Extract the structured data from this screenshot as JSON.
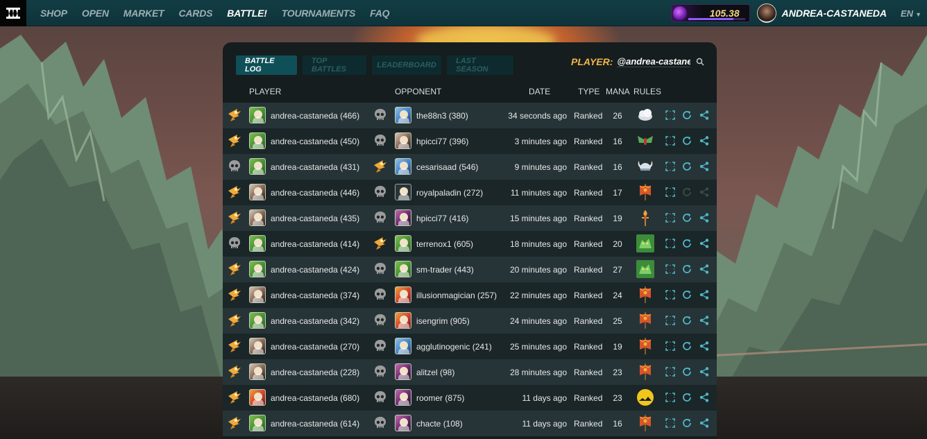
{
  "nav": {
    "items": [
      {
        "label": "SHOP",
        "active": false
      },
      {
        "label": "OPEN",
        "active": false
      },
      {
        "label": "MARKET",
        "active": false
      },
      {
        "label": "CARDS",
        "active": false
      },
      {
        "label": "BATTLE!",
        "active": true
      },
      {
        "label": "TOURNAMENTS",
        "active": false
      },
      {
        "label": "FAQ",
        "active": false
      }
    ],
    "balance": "105.38",
    "username": "ANDREA-CASTANEDA",
    "language": "EN"
  },
  "tabs": [
    {
      "label": "BATTLE LOG",
      "active": true
    },
    {
      "label": "TOP BATTLES",
      "active": false
    },
    {
      "label": "LEADERBOARD",
      "active": false
    },
    {
      "label": "LAST SEASON",
      "active": false
    }
  ],
  "search": {
    "label": "PLAYER:",
    "value": "@andrea-castaneda"
  },
  "columns": {
    "player": "PLAYER",
    "opponent": "OPPONENT",
    "date": "DATE",
    "type": "TYPE",
    "mana": "MANA",
    "rules": "RULES"
  },
  "colors": {
    "accent": "#f3b54b",
    "topbar": "#123d44",
    "panel": "#151d1e",
    "row_odd": "#263437",
    "row_even": "#1b2628",
    "icon": "#4fb8c9"
  },
  "battles": [
    {
      "player": "andrea-castaneda (466)",
      "player_result": "win",
      "player_card": "life",
      "opponent": "the88n3 (380)",
      "opponent_result": "loss",
      "opponent_card": "water",
      "date": "34 seconds ago",
      "type": "Ranked",
      "mana": "26",
      "rule_icon": "cloud-rule-icon",
      "replay_enabled": true
    },
    {
      "player": "andrea-castaneda (450)",
      "player_result": "win",
      "player_card": "life",
      "opponent": "hpicci77 (396)",
      "opponent_result": "loss",
      "opponent_card": "human",
      "date": "3 minutes ago",
      "type": "Ranked",
      "mana": "16",
      "rule_icon": "wings-rule-icon",
      "replay_enabled": true
    },
    {
      "player": "andrea-castaneda (431)",
      "player_result": "loss",
      "player_card": "life",
      "opponent": "cesarisaad (546)",
      "opponent_result": "win",
      "opponent_card": "water",
      "date": "9 minutes ago",
      "type": "Ranked",
      "mana": "16",
      "rule_icon": "viking-helmet-rule-icon",
      "replay_enabled": true
    },
    {
      "player": "andrea-castaneda (446)",
      "player_result": "win",
      "player_card": "human",
      "opponent": "royalpaladin (272)",
      "opponent_result": "loss",
      "opponent_card": "blank",
      "date": "11 minutes ago",
      "type": "Ranked",
      "mana": "17",
      "rule_icon": "banner-rule-icon",
      "replay_enabled": false
    },
    {
      "player": "andrea-castaneda (435)",
      "player_result": "win",
      "player_card": "human",
      "opponent": "hpicci77 (416)",
      "opponent_result": "loss",
      "opponent_card": "death",
      "date": "15 minutes ago",
      "type": "Ranked",
      "mana": "19",
      "rule_icon": "torch-rule-icon",
      "replay_enabled": true
    },
    {
      "player": "andrea-castaneda (414)",
      "player_result": "loss",
      "player_card": "life",
      "opponent": "terrenox1 (605)",
      "opponent_result": "win",
      "opponent_card": "life",
      "date": "18 minutes ago",
      "type": "Ranked",
      "mana": "20",
      "rule_icon": "earth-beast-rule-icon",
      "replay_enabled": true
    },
    {
      "player": "andrea-castaneda (424)",
      "player_result": "win",
      "player_card": "life",
      "opponent": "sm-trader (443)",
      "opponent_result": "loss",
      "opponent_card": "life",
      "date": "20 minutes ago",
      "type": "Ranked",
      "mana": "27",
      "rule_icon": "earth-beast-rule-icon",
      "replay_enabled": true
    },
    {
      "player": "andrea-castaneda (374)",
      "player_result": "win",
      "player_card": "human",
      "opponent": "illusionmagician (257)",
      "opponent_result": "loss",
      "opponent_card": "fire",
      "date": "22 minutes ago",
      "type": "Ranked",
      "mana": "24",
      "rule_icon": "banner-rule-icon",
      "replay_enabled": true
    },
    {
      "player": "andrea-castaneda (342)",
      "player_result": "win",
      "player_card": "life",
      "opponent": "isengrim (905)",
      "opponent_result": "loss",
      "opponent_card": "fire",
      "date": "24 minutes ago",
      "type": "Ranked",
      "mana": "25",
      "rule_icon": "banner-rule-icon",
      "replay_enabled": true
    },
    {
      "player": "andrea-castaneda (270)",
      "player_result": "win",
      "player_card": "human",
      "opponent": "agglutinogenic (241)",
      "opponent_result": "loss",
      "opponent_card": "water",
      "date": "25 minutes ago",
      "type": "Ranked",
      "mana": "19",
      "rule_icon": "banner-rule-icon",
      "replay_enabled": true
    },
    {
      "player": "andrea-castaneda (228)",
      "player_result": "win",
      "player_card": "human",
      "opponent": "alitzel (98)",
      "opponent_result": "loss",
      "opponent_card": "death",
      "date": "28 minutes ago",
      "type": "Ranked",
      "mana": "23",
      "rule_icon": "banner-rule-icon",
      "replay_enabled": true
    },
    {
      "player": "andrea-castaneda (680)",
      "player_result": "win",
      "player_card": "fire",
      "opponent": "roomer (875)",
      "opponent_result": "loss",
      "opponent_card": "death",
      "date": "11 days ago",
      "type": "Ranked",
      "mana": "23",
      "rule_icon": "yellow-moon-rule-icon",
      "replay_enabled": true
    },
    {
      "player": "andrea-castaneda (614)",
      "player_result": "win",
      "player_card": "life",
      "opponent": "chacte (108)",
      "opponent_result": "loss",
      "opponent_card": "death",
      "date": "11 days ago",
      "type": "Ranked",
      "mana": "16",
      "rule_icon": "banner-rule-icon",
      "replay_enabled": true
    }
  ]
}
